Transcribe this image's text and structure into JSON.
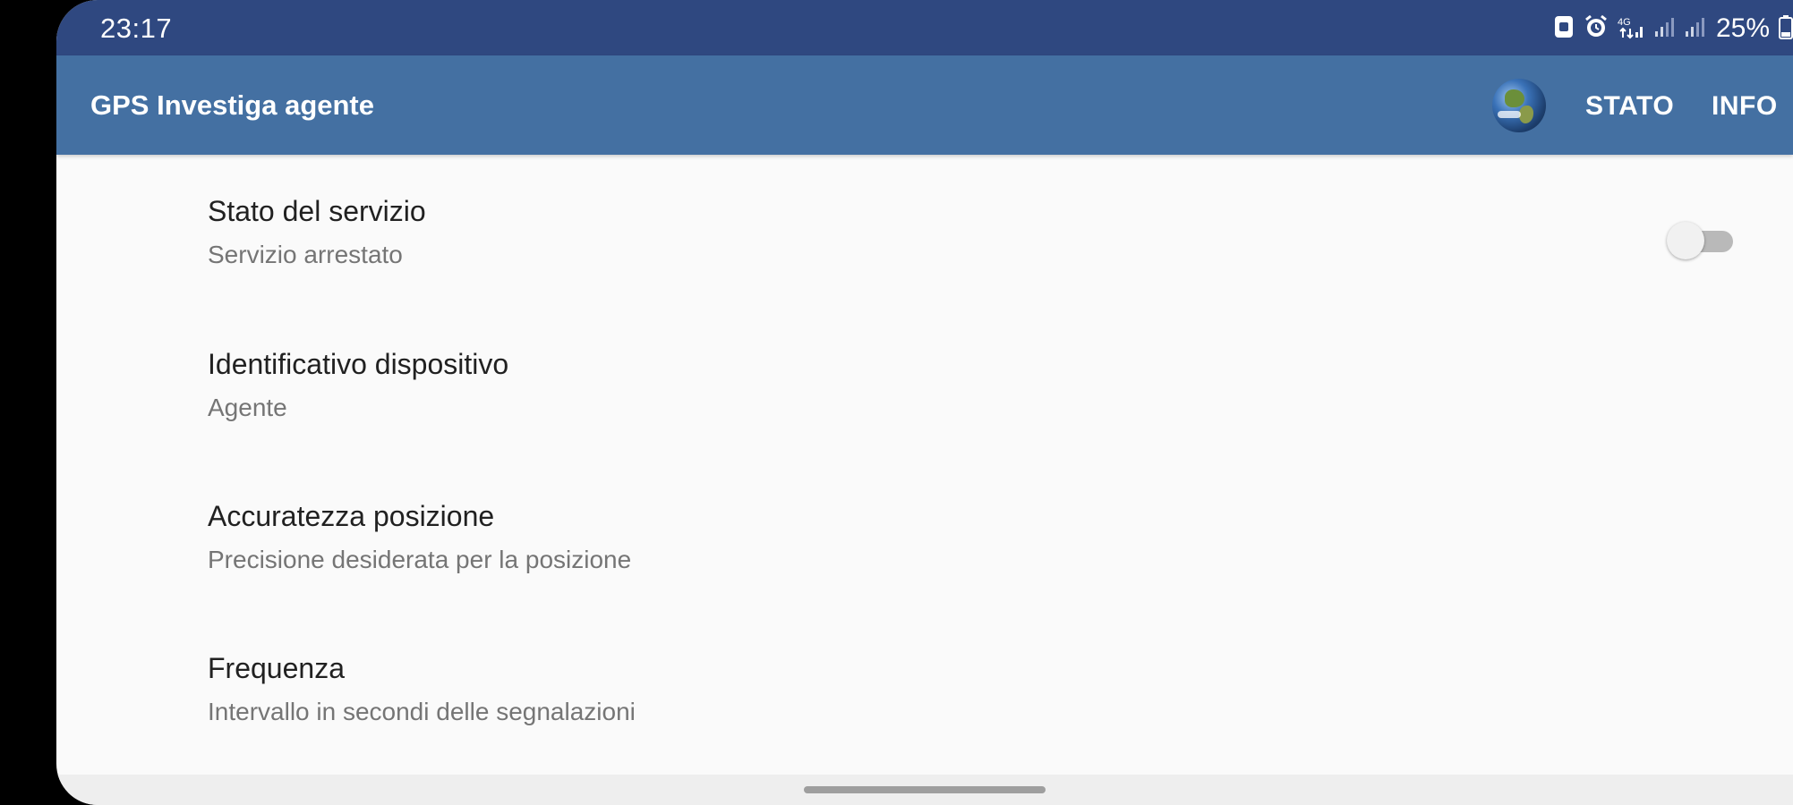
{
  "status_bar": {
    "time": "23:17",
    "battery": "25%",
    "icons": [
      "sim-icon",
      "alarm-icon",
      "data-icon",
      "signal-icon",
      "signal-icon",
      "battery-icon"
    ]
  },
  "app_bar": {
    "title": "GPS Investiga agente",
    "icon": "globe-icon",
    "actions": [
      "STATO",
      "INFO"
    ]
  },
  "preferences": [
    {
      "title": "Stato del servizio",
      "summary": "Servizio arrestato",
      "toggle": "off"
    },
    {
      "title": "Identificativo dispositivo",
      "summary": "Agente"
    },
    {
      "title": "Accuratezza posizione",
      "summary": "Precisione desiderata per la posizione"
    },
    {
      "title": "Frequenza",
      "summary": "Intervallo in secondi delle segnalazioni"
    }
  ],
  "colors": {
    "status_bar": "#2f4880",
    "app_bar": "#4470a2",
    "background": "#fafafa"
  }
}
